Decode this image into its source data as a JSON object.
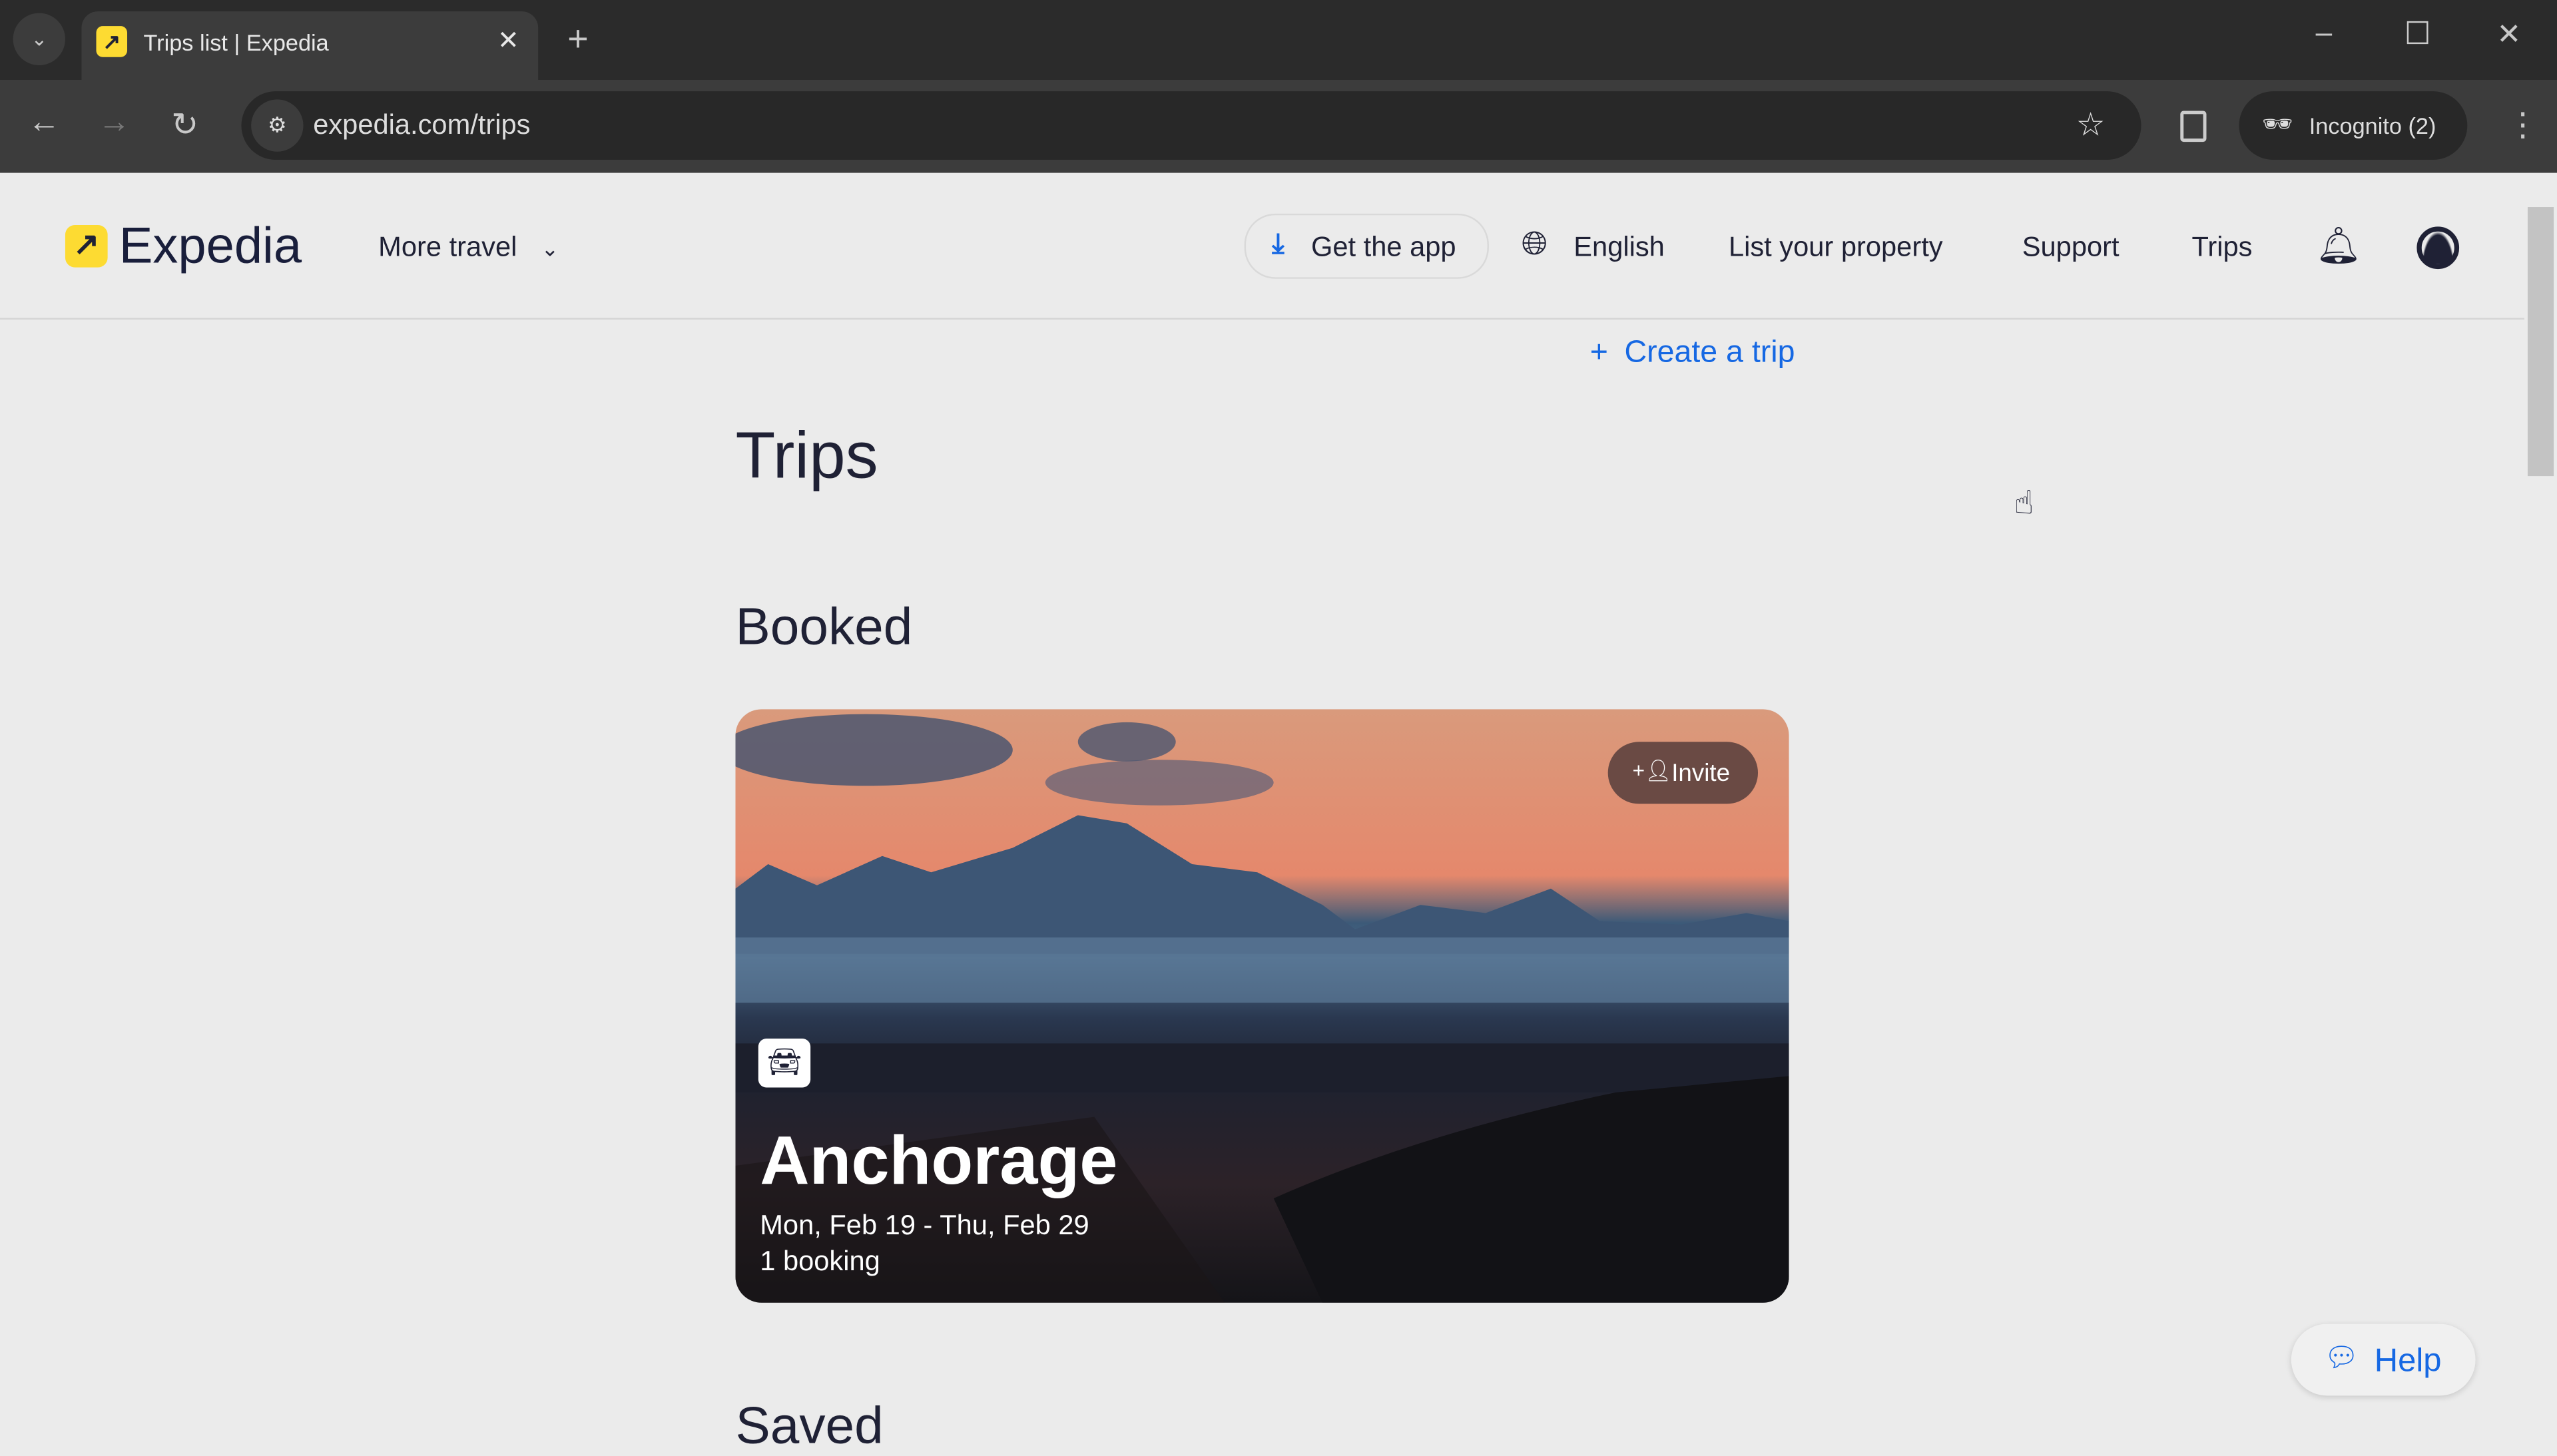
{
  "browser": {
    "tab_title": "Trips list | Expedia",
    "url": "expedia.com/trips",
    "profile": "Incognito (2)"
  },
  "header": {
    "logo": "Expedia",
    "more_travel": "More travel",
    "get_app": "Get the app",
    "language": "English",
    "list_property": "List your property",
    "support": "Support",
    "trips": "Trips"
  },
  "main": {
    "create_trip": "Create a trip",
    "title": "Trips",
    "booked_heading": "Booked",
    "saved_heading": "Saved",
    "trip_card": {
      "invite": "Invite",
      "icon": "car-icon",
      "destination": "Anchorage",
      "dates": "Mon, Feb 19 - Thu, Feb 29",
      "bookings": "1 booking"
    }
  },
  "help": "Help",
  "colors": {
    "accent": "#1668e3",
    "brand_yellow": "#fddb32",
    "text": "#1f2135"
  }
}
